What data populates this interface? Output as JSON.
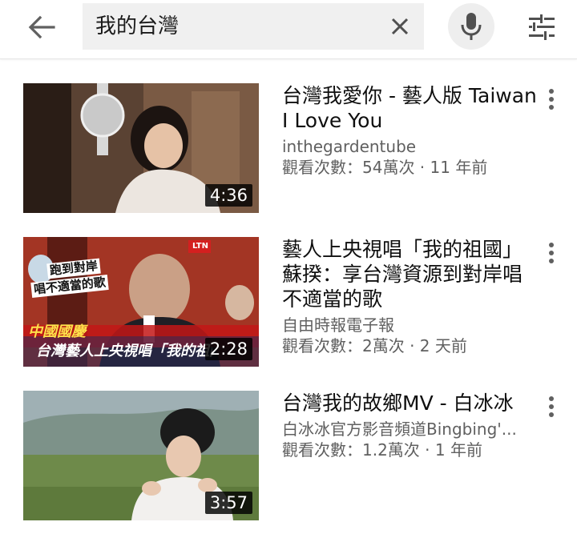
{
  "search": {
    "query": "我的台灣"
  },
  "icons": {
    "back": "arrow-left-icon",
    "clear": "close-icon",
    "mic": "microphone-icon",
    "filter": "tune-icon",
    "more": "more-vert-icon"
  },
  "results": [
    {
      "title": "台灣我愛你 - 藝人版 Taiwan I Love You",
      "channel": "inthegardentube",
      "meta": "觀看次數：54萬次 · 11 年前",
      "duration": "4:36"
    },
    {
      "title": "藝人上央視唱「我的祖國」 蘇揆：享台灣資源到對岸唱 不適當的歌",
      "channel": "自由時報電子報",
      "meta": "觀看次數：2萬次 · 2 天前",
      "duration": "2:28",
      "overlay": {
        "logo": "LTN",
        "caption_top": "跑到對岸",
        "caption_mid": "唱不適當的歌",
        "caption_band1": "中國國慶",
        "caption_band2": "台灣藝人上央視唱「我的祖國」"
      }
    },
    {
      "title": "台灣我的故鄉MV - 白冰冰",
      "channel": "白冰冰官方影音頻道Bingbing'...",
      "meta": "觀看次數：1.2萬次 · 1 年前",
      "duration": "3:57"
    }
  ]
}
